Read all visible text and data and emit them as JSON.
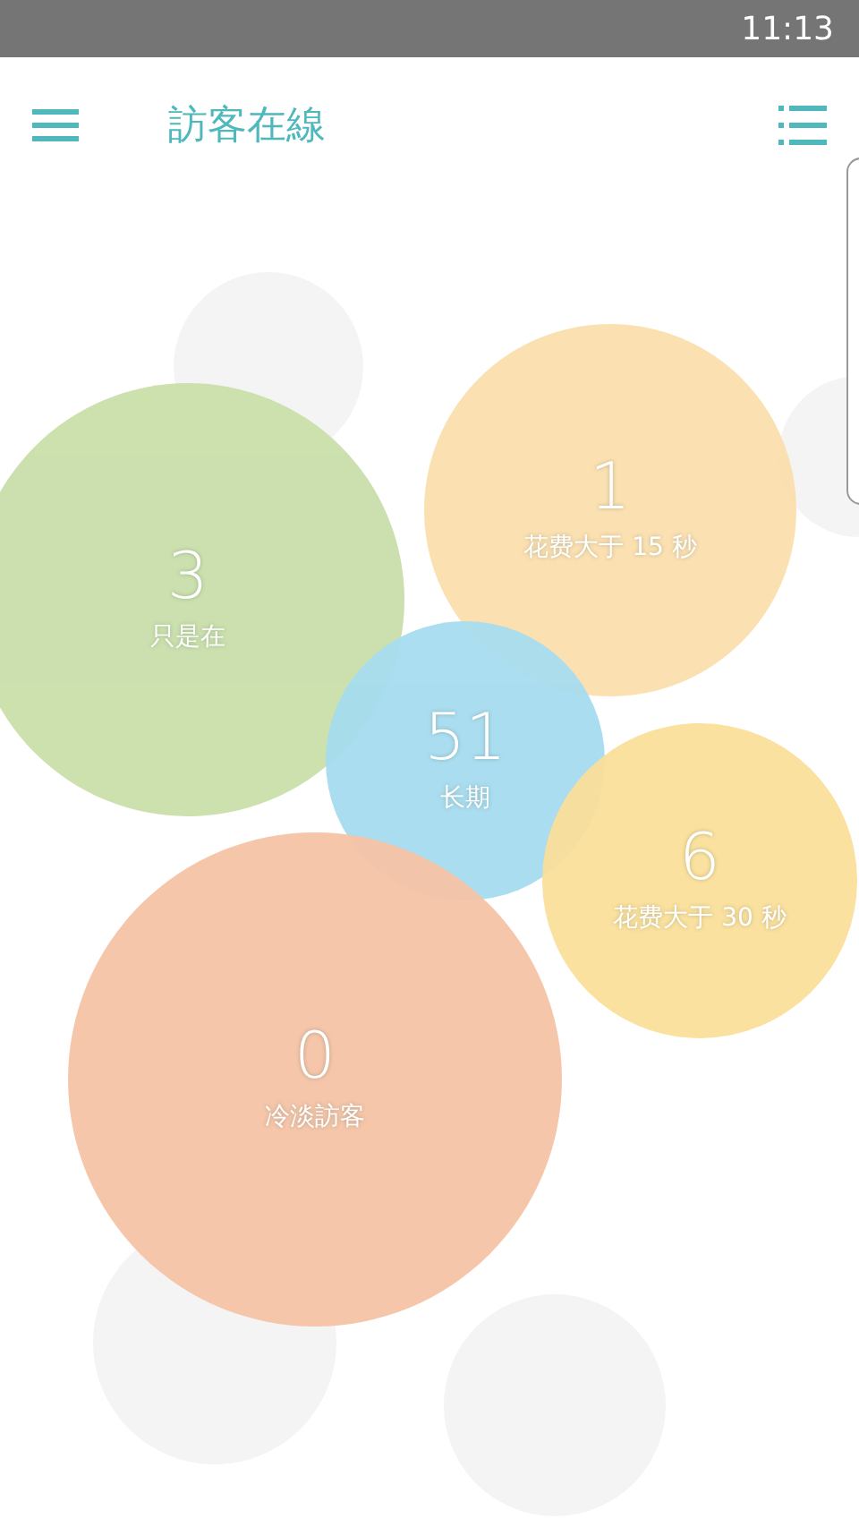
{
  "status_bar": {
    "time": "11:13"
  },
  "header": {
    "title": "訪客在線"
  },
  "bubbles": [
    {
      "count": "3",
      "label": "只是在",
      "color": "#c9dfaa"
    },
    {
      "count": "1",
      "label": "花费大于 15 秒",
      "color": "#fbdfae"
    },
    {
      "count": "51",
      "label": "长期",
      "color": "#a6dcef"
    },
    {
      "count": "6",
      "label": "花费大于 30 秒",
      "color": "#fbe09a"
    },
    {
      "count": "0",
      "label": "冷淡訪客",
      "color": "#f5c3a5"
    }
  ]
}
